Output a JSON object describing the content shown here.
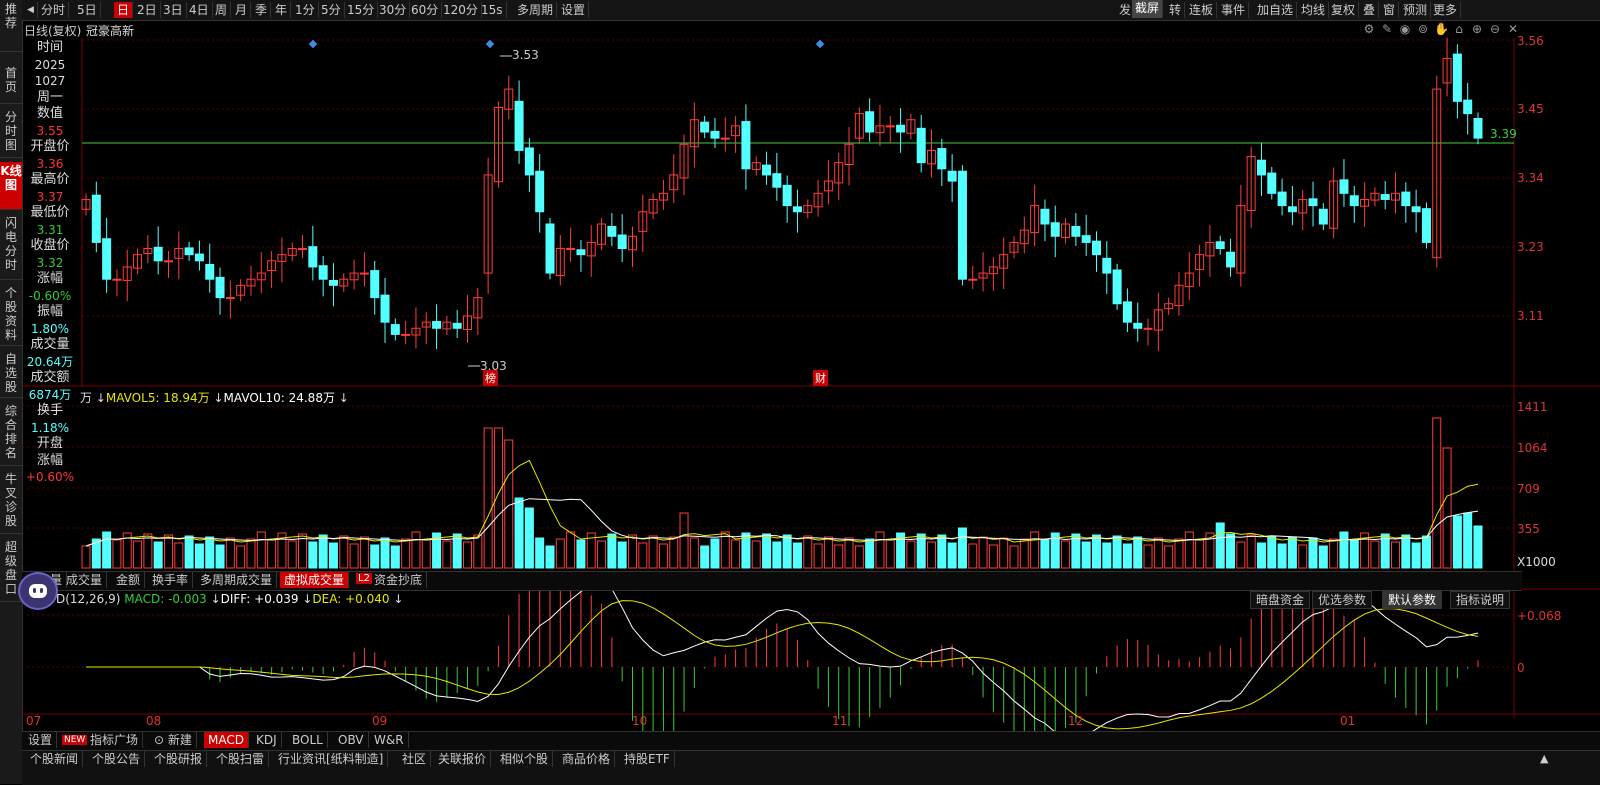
{
  "sidebar": {
    "items": [
      {
        "label": "推荐"
      },
      {
        "label": "首页"
      },
      {
        "label": "分时图"
      },
      {
        "label": "K线图"
      },
      {
        "label": "闪电分时"
      },
      {
        "label": "个股资料"
      },
      {
        "label": "自选股"
      },
      {
        "label": "综合排名"
      },
      {
        "label": "牛叉诊股"
      },
      {
        "label": "超级盘口"
      }
    ]
  },
  "toolbar": {
    "items": [
      "分时",
      "5日",
      "日",
      "2日",
      "3日",
      "4日",
      "周",
      "月",
      "季",
      "年",
      "1分",
      "5分",
      "15分",
      "30分",
      "60分",
      "120分",
      "15s",
      "多周期",
      "设置"
    ],
    "right_items": [
      "发",
      "截屏",
      "转",
      "连板",
      "事件",
      "加自选",
      "均线",
      "复权",
      "叠",
      "窗",
      "预测",
      "更多"
    ]
  },
  "title": {
    "period": "日线(复权)",
    "name": "冠豪高新"
  },
  "info_panel": {
    "time_label": "时间",
    "date_year": "2025",
    "date_md": "1027",
    "weekday": "周一",
    "value_label": "数值",
    "value": "3.55",
    "open_label": "开盘价",
    "open": "3.36",
    "high_label": "最高价",
    "high": "3.37",
    "low_label": "最低价",
    "low": "3.31",
    "close_label": "收盘价",
    "close": "3.32",
    "change_label": "涨幅",
    "change": "-0.60%",
    "amplitude_label": "振幅",
    "amplitude": "1.80%",
    "volume_label": "成交量",
    "volume": "20.64万",
    "amount_label": "成交额",
    "amount": "6874万",
    "turnover_label": "换手",
    "turnover": "1.18%",
    "open_change_label1": "开盘",
    "open_change_label2": "涨幅",
    "open_change": "+0.60%"
  },
  "price_axis": [
    "3.56",
    "3.45",
    "3.34",
    "3.23",
    "3.11"
  ],
  "annotations": {
    "max": "3.53",
    "min": "3.03",
    "last": "3.39",
    "marker_bang": "榜",
    "marker_cai": "财"
  },
  "volume_legend": {
    "prefix": "万",
    "mavol5": "MAVOL5: 18.94万",
    "mavol10": "MAVOL10: 24.88万"
  },
  "volume_axis": [
    "1411",
    "1064",
    "709",
    "355",
    "X1000"
  ],
  "indicator_tabs": [
    "量",
    "成交量",
    "金额",
    "换手率",
    "多周期成交量",
    "虚拟成交量",
    "资金抄底"
  ],
  "macd_legend": {
    "name": "D(12,26,9)",
    "macd": "MACD: -0.003",
    "diff": "DIFF: +0.039",
    "dea": "DEA: +0.040"
  },
  "macd_buttons": [
    "暗盘资金",
    "优选参数",
    "默认参数",
    "指标说明"
  ],
  "macd_axis": [
    "+0.068",
    "0"
  ],
  "date_axis": [
    "07",
    "08",
    "09",
    "10",
    "11",
    "12",
    "01"
  ],
  "bottom_indicator_tabs": [
    "设置",
    "NEW",
    "指标广场",
    "新建",
    "MACD",
    "KDJ",
    "BOLL",
    "OBV",
    "W&R"
  ],
  "bottom_news_tabs": [
    "个股新闻",
    "个股公告",
    "个股研报",
    "个股扫雷",
    "行业资讯[纸料制造]",
    "社区",
    "关联报价",
    "相似个股",
    "商品价格",
    "持股ETF"
  ],
  "colors": {
    "up": "#ff3c3c",
    "down": "#54ffff",
    "ma5": "#ffffff",
    "ma10": "#e6e600",
    "grid": "#5a0000",
    "last_price_line": "#3fcf3f"
  }
}
